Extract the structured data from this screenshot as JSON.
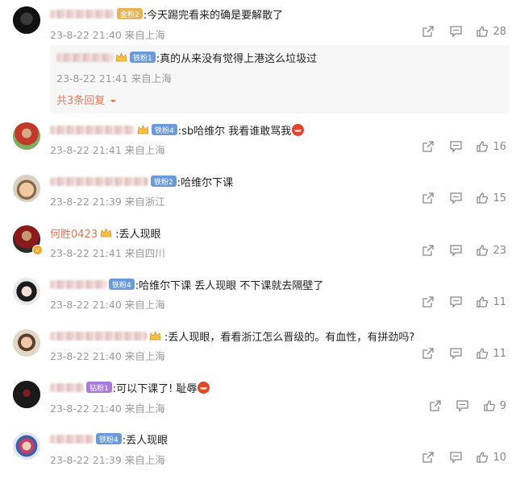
{
  "comments": [
    {
      "id": "c1",
      "name": "",
      "crown": false,
      "fan_badge": "金粉2",
      "fan_color": "#e6b45a",
      "text": ":今天踢完看来的确是要解散了",
      "emoji": false,
      "time": "23-8-22 21:40",
      "location": "来自上海",
      "likes": "28",
      "verified": false
    },
    {
      "id": "c2",
      "name": "",
      "crown": true,
      "fan_badge": "铁粉4",
      "fan_color": "#6a9bd8",
      "text": ":sb哈维尔 我看谁敢骂我",
      "emoji": true,
      "time": "23-8-22 21:41",
      "location": "来自上海",
      "likes": "16",
      "verified": false
    },
    {
      "id": "c3",
      "name": "",
      "crown": false,
      "fan_badge": "铁粉2",
      "fan_color": "#6a9bd8",
      "text": ":哈维尔下课",
      "emoji": false,
      "time": "23-8-22 21:39",
      "location": "来自浙江",
      "likes": "15",
      "verified": false
    },
    {
      "id": "c4",
      "name": "何胜0423",
      "crown": true,
      "fan_badge": "",
      "fan_color": "",
      "text": ":丢人现眼",
      "emoji": false,
      "time": "23-8-22 21:41",
      "location": "来自四川",
      "likes": "23",
      "verified": true
    },
    {
      "id": "c5",
      "name": "",
      "crown": false,
      "fan_badge": "铁粉4",
      "fan_color": "#6a9bd8",
      "text": ":哈维尔下课 丢人现眼 不下课就去隔壁了",
      "emoji": false,
      "time": "23-8-22 21:40",
      "location": "来自上海",
      "likes": "11",
      "verified": false
    },
    {
      "id": "c6",
      "name": "",
      "crown": true,
      "fan_badge": "",
      "fan_color": "",
      "text": ":丢人现眼，看看浙江怎么晋级的。有血性，有拼劲吗?",
      "emoji": false,
      "time": "23-8-22 21:40",
      "location": "来自上海",
      "likes": "11",
      "verified": false
    },
    {
      "id": "c7",
      "name": "",
      "crown": false,
      "fan_badge": "钻粉1",
      "fan_color": "#a97bd9",
      "text": ":可以下课了! 耻辱",
      "emoji": true,
      "time": "23-8-22 21:40",
      "location": "来自上海",
      "likes": "9",
      "verified": false
    },
    {
      "id": "c8",
      "name": "",
      "crown": false,
      "fan_badge": "铁粉4",
      "fan_color": "#6a9bd8",
      "text": ":丢人现眼",
      "emoji": false,
      "time": "23-8-22 21:39",
      "location": "来自上海",
      "likes": "10",
      "verified": false
    }
  ],
  "reply": {
    "fan_badge": "铁粉1",
    "text": ":真的从来没有觉得上港这么垃圾过",
    "time": "23-8-22 21:41",
    "location": "来自上海",
    "more_label": "共3条回复"
  },
  "icons": {
    "share": "share-icon",
    "comment": "comment-icon",
    "like": "thumbs-up-icon",
    "more": "chevron-down-icon"
  },
  "colors": {
    "username": "#eb7350",
    "meta": "#999999",
    "reply_bg": "#f7f7f7"
  }
}
